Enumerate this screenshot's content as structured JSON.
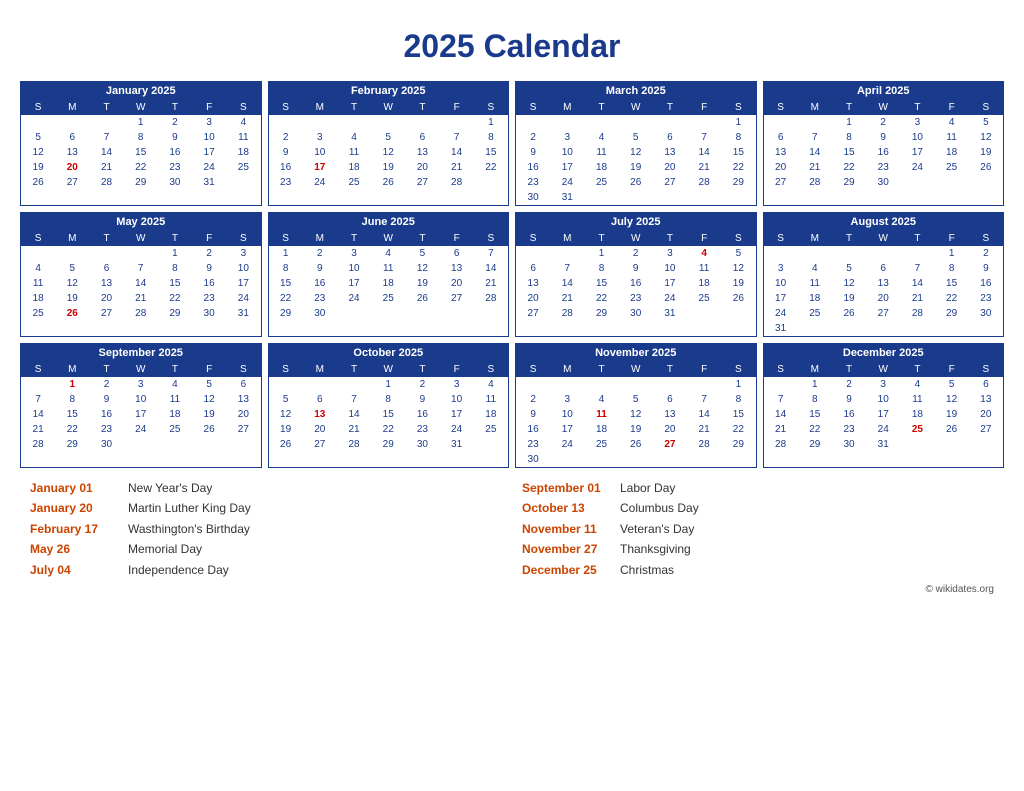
{
  "title": "2025 Calendar",
  "months": [
    {
      "name": "January 2025",
      "days_header": [
        "S",
        "M",
        "T",
        "W",
        "T",
        "F",
        "S"
      ],
      "weeks": [
        [
          "",
          "",
          "",
          "1",
          "2",
          "3",
          "4"
        ],
        [
          "5",
          "6",
          "7",
          "8",
          "9",
          "10",
          "11"
        ],
        [
          "12",
          "13",
          "14",
          "15",
          "16",
          "17",
          "18"
        ],
        [
          "19",
          "20",
          "21",
          "22",
          "23",
          "24",
          "25"
        ],
        [
          "26",
          "27",
          "28",
          "29",
          "30",
          "31",
          ""
        ]
      ],
      "holidays": [
        "1",
        "20"
      ],
      "red_dates": [
        "20"
      ]
    },
    {
      "name": "February 2025",
      "days_header": [
        "S",
        "M",
        "T",
        "W",
        "T",
        "F",
        "S"
      ],
      "weeks": [
        [
          "",
          "",
          "",
          "",
          "",
          "",
          "1"
        ],
        [
          "2",
          "3",
          "4",
          "5",
          "6",
          "7",
          "8"
        ],
        [
          "9",
          "10",
          "11",
          "12",
          "13",
          "14",
          "15"
        ],
        [
          "16",
          "17",
          "18",
          "19",
          "20",
          "21",
          "22"
        ],
        [
          "23",
          "24",
          "25",
          "26",
          "27",
          "28",
          ""
        ]
      ],
      "holidays": [
        "17"
      ],
      "red_dates": [
        "17"
      ]
    },
    {
      "name": "March 2025",
      "days_header": [
        "S",
        "M",
        "T",
        "W",
        "T",
        "F",
        "S"
      ],
      "weeks": [
        [
          "",
          "",
          "",
          "",
          "",
          "",
          "1"
        ],
        [
          "2",
          "3",
          "4",
          "5",
          "6",
          "7",
          "8"
        ],
        [
          "9",
          "10",
          "11",
          "12",
          "13",
          "14",
          "15"
        ],
        [
          "16",
          "17",
          "18",
          "19",
          "20",
          "21",
          "22"
        ],
        [
          "23",
          "24",
          "25",
          "26",
          "27",
          "28",
          "29"
        ],
        [
          "30",
          "31",
          "",
          "",
          "",
          "",
          ""
        ]
      ],
      "holidays": [],
      "red_dates": []
    },
    {
      "name": "April 2025",
      "days_header": [
        "S",
        "M",
        "T",
        "W",
        "T",
        "F",
        "S"
      ],
      "weeks": [
        [
          "",
          "",
          "1",
          "2",
          "3",
          "4",
          "5"
        ],
        [
          "6",
          "7",
          "8",
          "9",
          "10",
          "11",
          "12"
        ],
        [
          "13",
          "14",
          "15",
          "16",
          "17",
          "18",
          "19"
        ],
        [
          "20",
          "21",
          "22",
          "23",
          "24",
          "25",
          "26"
        ],
        [
          "27",
          "28",
          "29",
          "30",
          "",
          "",
          ""
        ]
      ],
      "holidays": [],
      "red_dates": []
    },
    {
      "name": "May 2025",
      "days_header": [
        "S",
        "M",
        "T",
        "W",
        "T",
        "F",
        "S"
      ],
      "weeks": [
        [
          "",
          "",
          "",
          "",
          "1",
          "2",
          "3"
        ],
        [
          "4",
          "5",
          "6",
          "7",
          "8",
          "9",
          "10"
        ],
        [
          "11",
          "12",
          "13",
          "14",
          "15",
          "16",
          "17"
        ],
        [
          "18",
          "19",
          "20",
          "21",
          "22",
          "23",
          "24"
        ],
        [
          "25",
          "26",
          "27",
          "28",
          "29",
          "30",
          "31"
        ]
      ],
      "holidays": [
        "26"
      ],
      "red_dates": [
        "26"
      ]
    },
    {
      "name": "June 2025",
      "days_header": [
        "S",
        "M",
        "T",
        "W",
        "T",
        "F",
        "S"
      ],
      "weeks": [
        [
          "1",
          "2",
          "3",
          "4",
          "5",
          "6",
          "7"
        ],
        [
          "8",
          "9",
          "10",
          "11",
          "12",
          "13",
          "14"
        ],
        [
          "15",
          "16",
          "17",
          "18",
          "19",
          "20",
          "21"
        ],
        [
          "22",
          "23",
          "24",
          "25",
          "26",
          "27",
          "28"
        ],
        [
          "29",
          "30",
          "",
          "",
          "",
          "",
          ""
        ]
      ],
      "holidays": [],
      "red_dates": []
    },
    {
      "name": "July 2025",
      "days_header": [
        "S",
        "M",
        "T",
        "W",
        "T",
        "F",
        "S"
      ],
      "weeks": [
        [
          "",
          "",
          "1",
          "2",
          "3",
          "4",
          "5"
        ],
        [
          "6",
          "7",
          "8",
          "9",
          "10",
          "11",
          "12"
        ],
        [
          "13",
          "14",
          "15",
          "16",
          "17",
          "18",
          "19"
        ],
        [
          "20",
          "21",
          "22",
          "23",
          "24",
          "25",
          "26"
        ],
        [
          "27",
          "28",
          "29",
          "30",
          "31",
          "",
          ""
        ]
      ],
      "holidays": [
        "4"
      ],
      "red_dates": [
        "4"
      ]
    },
    {
      "name": "August 2025",
      "days_header": [
        "S",
        "M",
        "T",
        "W",
        "T",
        "F",
        "S"
      ],
      "weeks": [
        [
          "",
          "",
          "",
          "",
          "",
          "1",
          "2"
        ],
        [
          "3",
          "4",
          "5",
          "6",
          "7",
          "8",
          "9"
        ],
        [
          "10",
          "11",
          "12",
          "13",
          "14",
          "15",
          "16"
        ],
        [
          "17",
          "18",
          "19",
          "20",
          "21",
          "22",
          "23"
        ],
        [
          "24",
          "25",
          "26",
          "27",
          "28",
          "29",
          "30"
        ],
        [
          "31",
          "",
          "",
          "",
          "",
          "",
          ""
        ]
      ],
      "holidays": [],
      "red_dates": []
    },
    {
      "name": "September 2025",
      "days_header": [
        "S",
        "M",
        "T",
        "W",
        "T",
        "F",
        "S"
      ],
      "weeks": [
        [
          "",
          "1",
          "2",
          "3",
          "4",
          "5",
          "6"
        ],
        [
          "7",
          "8",
          "9",
          "10",
          "11",
          "12",
          "13"
        ],
        [
          "14",
          "15",
          "16",
          "17",
          "18",
          "19",
          "20"
        ],
        [
          "21",
          "22",
          "23",
          "24",
          "25",
          "26",
          "27"
        ],
        [
          "28",
          "29",
          "30",
          "",
          "",
          "",
          ""
        ]
      ],
      "holidays": [
        "1"
      ],
      "red_dates": [
        "1"
      ]
    },
    {
      "name": "October 2025",
      "days_header": [
        "S",
        "M",
        "T",
        "W",
        "T",
        "F",
        "S"
      ],
      "weeks": [
        [
          "",
          "",
          "",
          "1",
          "2",
          "3",
          "4"
        ],
        [
          "5",
          "6",
          "7",
          "8",
          "9",
          "10",
          "11"
        ],
        [
          "12",
          "13",
          "14",
          "15",
          "16",
          "17",
          "18"
        ],
        [
          "19",
          "20",
          "21",
          "22",
          "23",
          "24",
          "25"
        ],
        [
          "26",
          "27",
          "28",
          "29",
          "30",
          "31",
          ""
        ]
      ],
      "holidays": [
        "13"
      ],
      "red_dates": [
        "13"
      ]
    },
    {
      "name": "November 2025",
      "days_header": [
        "S",
        "M",
        "T",
        "W",
        "T",
        "F",
        "S"
      ],
      "weeks": [
        [
          "",
          "",
          "",
          "",
          "",
          "",
          "1"
        ],
        [
          "2",
          "3",
          "4",
          "5",
          "6",
          "7",
          "8"
        ],
        [
          "9",
          "10",
          "11",
          "12",
          "13",
          "14",
          "15"
        ],
        [
          "16",
          "17",
          "18",
          "19",
          "20",
          "21",
          "22"
        ],
        [
          "23",
          "24",
          "25",
          "26",
          "27",
          "28",
          "29"
        ],
        [
          "30",
          "",
          "",
          "",
          "",
          "",
          ""
        ]
      ],
      "holidays": [
        "11",
        "27"
      ],
      "red_dates": [
        "11",
        "27"
      ]
    },
    {
      "name": "December 2025",
      "days_header": [
        "S",
        "M",
        "T",
        "W",
        "T",
        "F",
        "S"
      ],
      "weeks": [
        [
          "",
          "1",
          "2",
          "3",
          "4",
          "5",
          "6"
        ],
        [
          "7",
          "8",
          "9",
          "10",
          "11",
          "12",
          "13"
        ],
        [
          "14",
          "15",
          "16",
          "17",
          "18",
          "19",
          "20"
        ],
        [
          "21",
          "22",
          "23",
          "24",
          "25",
          "26",
          "27"
        ],
        [
          "28",
          "29",
          "30",
          "31",
          "",
          "",
          ""
        ]
      ],
      "holidays": [
        "25"
      ],
      "red_dates": [
        "25"
      ]
    }
  ],
  "holidays_list": [
    {
      "date": "January 01",
      "name": "New Year's Day"
    },
    {
      "date": "January 20",
      "name": "Martin Luther King Day"
    },
    {
      "date": "February 17",
      "name": "Wasthington's Birthday"
    },
    {
      "date": "May 26",
      "name": "Memorial Day"
    },
    {
      "date": "July 04",
      "name": "Independence Day"
    },
    {
      "date": "September 01",
      "name": "Labor Day"
    },
    {
      "date": "October 13",
      "name": "Columbus Day"
    },
    {
      "date": "November 11",
      "name": "Veteran's Day"
    },
    {
      "date": "November 27",
      "name": "Thanksgiving"
    },
    {
      "date": "December 25",
      "name": "Christmas"
    }
  ],
  "copyright": "© wikidates.org"
}
